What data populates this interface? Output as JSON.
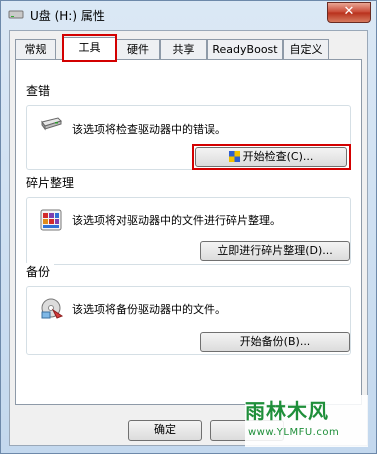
{
  "window": {
    "title": "U盘 (H:) 属性",
    "close_glyph": "✕"
  },
  "tabs": [
    {
      "label": "常规",
      "active": false
    },
    {
      "label": "工具",
      "active": true
    },
    {
      "label": "硬件",
      "active": false
    },
    {
      "label": "共享",
      "active": false
    },
    {
      "label": "ReadyBoost",
      "active": false
    },
    {
      "label": "自定义",
      "active": false
    }
  ],
  "groups": {
    "error_check": {
      "title": "查错",
      "description": "该选项将检查驱动器中的错误。",
      "button": "开始检查(C)...",
      "icon": "drive-check-icon"
    },
    "defrag": {
      "title": "碎片整理",
      "description": "该选项将对驱动器中的文件进行碎片整理。",
      "button": "立即进行碎片整理(D)...",
      "icon": "defrag-icon"
    },
    "backup": {
      "title": "备份",
      "description": "该选项将备份驱动器中的文件。",
      "button": "开始备份(B)...",
      "icon": "backup-icon"
    }
  },
  "footer": {
    "ok": "确定"
  },
  "watermark": {
    "logo": "雨林木风",
    "url": "www.YLMFU.com"
  },
  "colors": {
    "highlight": "#d30000",
    "title_bar": "#c3d8ee",
    "close_button": "#c74632"
  }
}
